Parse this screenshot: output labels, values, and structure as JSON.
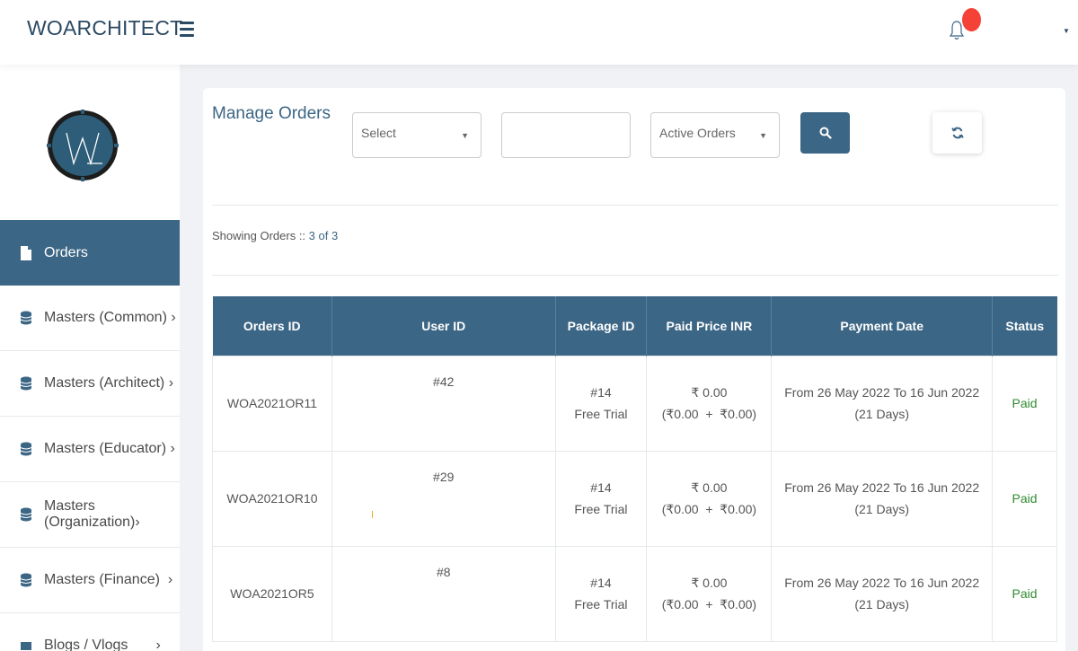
{
  "header": {
    "brand": "WOARCHITECT"
  },
  "sidebar": {
    "items": [
      {
        "label": "Orders",
        "active": true,
        "icon": "file-icon"
      },
      {
        "label": "Masters (Common) ›",
        "icon": "database-icon"
      },
      {
        "label": "Masters (Architect) ›",
        "icon": "database-icon"
      },
      {
        "label": "Masters (Educator) ›",
        "icon": "database-icon"
      },
      {
        "label": "Masters (Organization)›",
        "icon": "database-icon"
      },
      {
        "label": "Masters (Finance)  ›",
        "icon": "database-icon"
      },
      {
        "label": "Blogs / Vlogs       ›",
        "icon": "video-icon"
      }
    ]
  },
  "main": {
    "title": "Manage Orders",
    "filters": {
      "select1": "Select",
      "text_value": "",
      "select2": "Active Orders"
    },
    "showing_label": "Showing Orders ::",
    "showing_count": "3 of 3",
    "table": {
      "headers": [
        "Orders ID",
        "User ID",
        "Package ID",
        "Paid Price INR",
        "Payment Date",
        "Status"
      ],
      "rows": [
        {
          "order_id": "WOA2021OR11",
          "user_id": "#42",
          "package_id": "#14",
          "package_name": "Free Trial",
          "price": "₹ 0.00",
          "price_breakdown": "(₹0.00  +  ₹0.00)",
          "date_range": "From 26 May 2022 To 16 Jun 2022",
          "duration": "(21 Days)",
          "status": "Paid"
        },
        {
          "order_id": "WOA2021OR10",
          "user_id": "#29",
          "package_id": "#14",
          "package_name": "Free Trial",
          "price": "₹ 0.00",
          "price_breakdown": "(₹0.00  +  ₹0.00)",
          "date_range": "From 26 May 2022 To 16 Jun 2022",
          "duration": "(21 Days)",
          "status": "Paid"
        },
        {
          "order_id": "WOA2021OR5",
          "user_id": "#8",
          "package_id": "#14",
          "package_name": "Free Trial",
          "price": "₹ 0.00",
          "price_breakdown": "(₹0.00  +  ₹0.00)",
          "date_range": "From 26 May 2022 To 16 Jun 2022",
          "duration": "(21 Days)",
          "status": "Paid"
        }
      ]
    }
  },
  "colors": {
    "primary": "#3c6685",
    "notification": "#f44336",
    "paid": "#2e8b2e"
  }
}
